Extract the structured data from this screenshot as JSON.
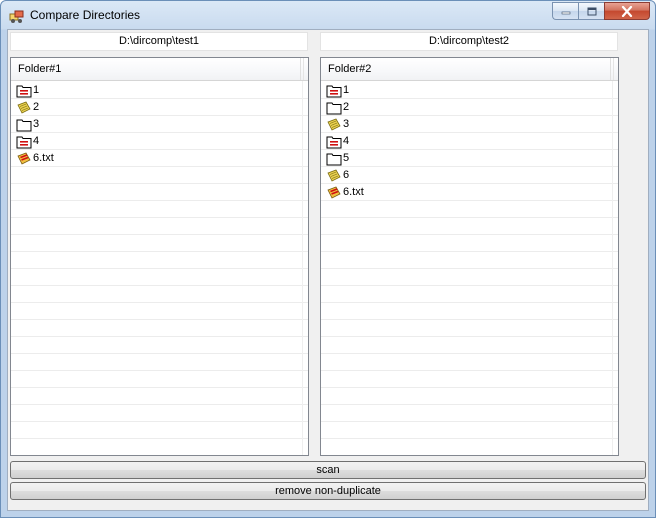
{
  "window": {
    "title": "Compare Directories"
  },
  "left_panel": {
    "path": "D:\\dircomp\\test1",
    "column_header": "Folder#1",
    "items": [
      {
        "label": "1",
        "icon": "folder-red-icon"
      },
      {
        "label": "2",
        "icon": "note-yellow-icon"
      },
      {
        "label": "3",
        "icon": "folder-icon"
      },
      {
        "label": "4",
        "icon": "folder-red-icon"
      },
      {
        "label": "6.txt",
        "icon": "file-red-icon"
      }
    ]
  },
  "right_panel": {
    "path": "D:\\dircomp\\test2",
    "column_header": "Folder#2",
    "items": [
      {
        "label": "1",
        "icon": "folder-red-icon"
      },
      {
        "label": "2",
        "icon": "folder-icon"
      },
      {
        "label": "3",
        "icon": "note-yellow-icon"
      },
      {
        "label": "4",
        "icon": "folder-red-icon"
      },
      {
        "label": "5",
        "icon": "folder-icon"
      },
      {
        "label": "6",
        "icon": "note-yellow-icon"
      },
      {
        "label": "6.txt",
        "icon": "file-red-icon"
      }
    ]
  },
  "buttons": {
    "scan": "scan",
    "remove": "remove non-duplicate"
  },
  "colors": {
    "red_mark": "#d01010",
    "yellow_note": "#e8d050",
    "folder_stroke": "#000000"
  }
}
